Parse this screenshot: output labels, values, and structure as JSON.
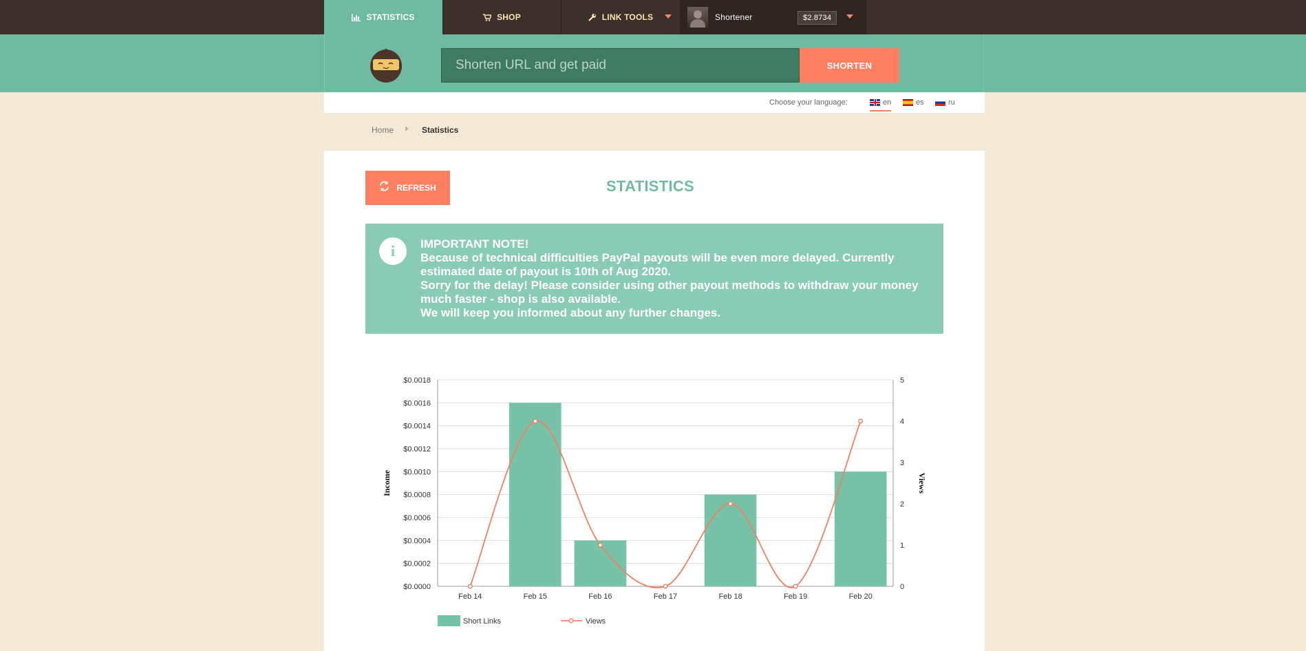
{
  "nav": {
    "tabs": [
      {
        "label": "STATISTICS",
        "icon": "bar-chart-icon",
        "active": true
      },
      {
        "label": "SHOP",
        "icon": "cart-icon"
      },
      {
        "label": "LINK TOOLS",
        "icon": "wrench-icon"
      }
    ],
    "user": {
      "name": "Shortener",
      "balance": "$2.8734"
    }
  },
  "header": {
    "url_placeholder": "Shorten URL and get paid",
    "shorten_label": "SHORTEN"
  },
  "language": {
    "label": "Choose your language:",
    "options": [
      {
        "code": "en",
        "active": true
      },
      {
        "code": "es"
      },
      {
        "code": "ru"
      }
    ]
  },
  "breadcrumb": {
    "home": "Home",
    "current": "Statistics"
  },
  "page": {
    "refresh_label": "REFRESH",
    "title": "STATISTICS"
  },
  "note": {
    "heading": "IMPORTANT NOTE!",
    "line1": "Because of technical difficulties PayPal payouts will be even more delayed. Currently estimated date of payout is 10th of Aug 2020.",
    "line2": "Sorry for the delay! Please consider using other payout methods to withdraw your money much faster - shop is also available.",
    "line3": "We will keep you informed about any further changes."
  },
  "colors": {
    "accent": "#6fbaa0",
    "button": "#ff8060",
    "topbar": "#3c302b",
    "line": "#f27f64",
    "bar": "#78c2a7"
  },
  "chart_data": {
    "type": "bar",
    "categories": [
      "Feb 14",
      "Feb 15",
      "Feb 16",
      "Feb 17",
      "Feb 18",
      "Feb 19",
      "Feb 20"
    ],
    "ylabel": "Income",
    "y2label": "Views",
    "ylim": [
      0,
      0.0018
    ],
    "y2lim": [
      0,
      5
    ],
    "y_ticks": [
      "$0.0000",
      "$0.0002",
      "$0.0004",
      "$0.0006",
      "$0.0008",
      "$0.0010",
      "$0.0012",
      "$0.0014",
      "$0.0016",
      "$0.0018"
    ],
    "y2_ticks": [
      "0",
      "1",
      "2",
      "3",
      "4",
      "5"
    ],
    "grid": true,
    "legend": "bottom-left",
    "series": [
      {
        "name": "Short Links",
        "type": "bar",
        "axis": "left",
        "values": [
          0,
          0.0016,
          0.0004,
          0,
          0.0008,
          0,
          0.001
        ]
      },
      {
        "name": "Views",
        "type": "line",
        "axis": "right",
        "values": [
          0,
          4,
          1,
          0,
          2,
          0,
          4
        ]
      }
    ]
  }
}
